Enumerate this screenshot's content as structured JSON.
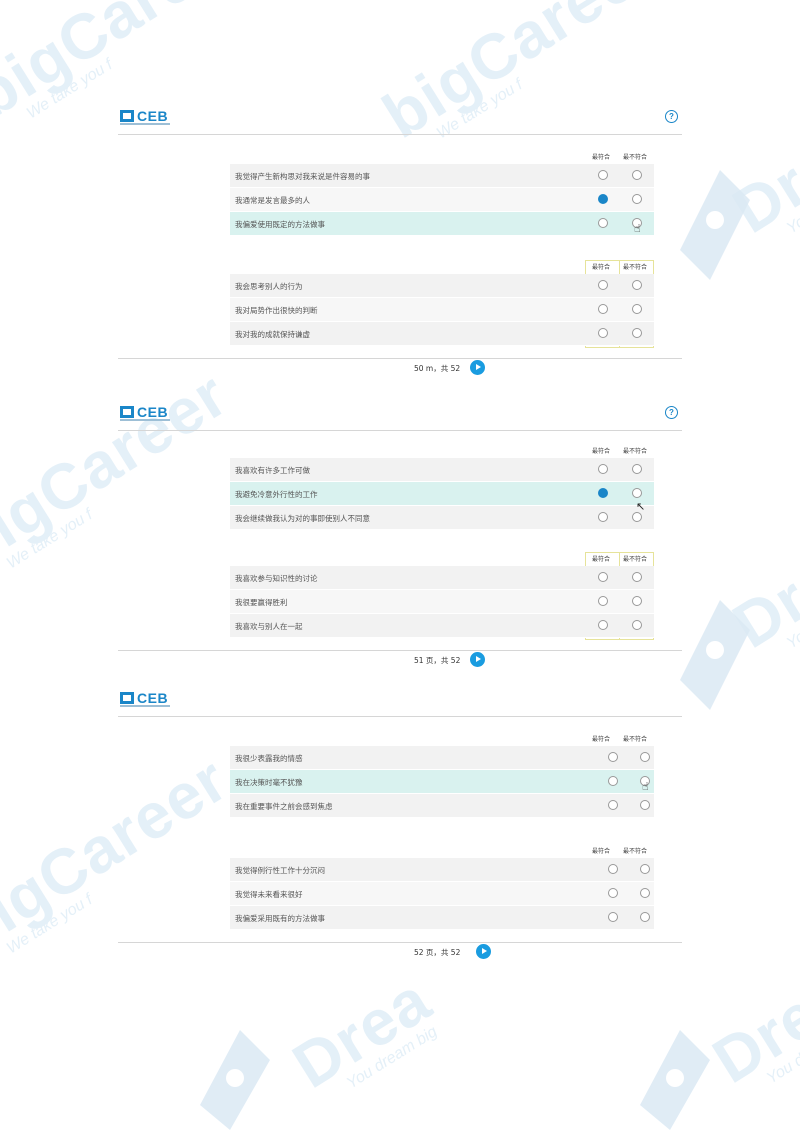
{
  "watermarks": {
    "big_career": "bigCareer",
    "career_tag": "We take you f",
    "dream": "Drea",
    "dream_tag": "You dream big"
  },
  "pages": [
    {
      "logo": "CEB",
      "help": "?",
      "footer": "50 m，共 52",
      "blocks": [
        {
          "col_most": "最符合",
          "col_least": "最不符合",
          "rows": [
            {
              "text": "我觉得产生新构思对我来说是件容易的事",
              "most": false,
              "least": false
            },
            {
              "text": "我通常是发言最多的人",
              "most": true,
              "least": false
            },
            {
              "text": "我偏爱使用既定的方法做事",
              "most": false,
              "least": false
            }
          ]
        },
        {
          "col_most": "最符合",
          "col_least": "最不符合",
          "rows": [
            {
              "text": "我会思考别人的行为",
              "most": false,
              "least": false
            },
            {
              "text": "我对局势作出很快的判断",
              "most": false,
              "least": false
            },
            {
              "text": "我对我的成就保持谦虚",
              "most": false,
              "least": false
            }
          ]
        }
      ]
    },
    {
      "logo": "CEB",
      "help": "?",
      "footer": "51 页，共 52",
      "blocks": [
        {
          "col_most": "最符合",
          "col_least": "最不符合",
          "rows": [
            {
              "text": "我喜欢有许多工作可做",
              "most": false,
              "least": false
            },
            {
              "text": "我避免冷意外行性的工作",
              "most": true,
              "least": false
            },
            {
              "text": "我会继续做我认为对的事即使别人不同意",
              "most": false,
              "least": false
            }
          ]
        },
        {
          "col_most": "最符合",
          "col_least": "最不符合",
          "rows": [
            {
              "text": "我喜欢参与知识性的讨论",
              "most": false,
              "least": false
            },
            {
              "text": "我很要赢得胜利",
              "most": false,
              "least": false
            },
            {
              "text": "我喜欢与别人在一起",
              "most": false,
              "least": false
            }
          ]
        }
      ]
    },
    {
      "logo": "CEB",
      "help": "?",
      "footer": "52 页，共 52",
      "blocks": [
        {
          "col_most": "最符合",
          "col_least": "最不符合",
          "rows": [
            {
              "text": "我很少表露我的情感",
              "most": false,
              "least": false
            },
            {
              "text": "我在决策时毫不犹豫",
              "most": false,
              "least": false
            },
            {
              "text": "我在重要事件之前会感到焦虑",
              "most": false,
              "least": false
            }
          ]
        },
        {
          "col_most": "最符合",
          "col_least": "最不符合",
          "rows": [
            {
              "text": "我觉得例行性工作十分沉闷",
              "most": false,
              "least": false
            },
            {
              "text": "我觉得未来看来很好",
              "most": false,
              "least": false
            },
            {
              "text": "我偏爱采用既有的方法做事",
              "most": false,
              "least": false
            }
          ]
        }
      ]
    }
  ]
}
